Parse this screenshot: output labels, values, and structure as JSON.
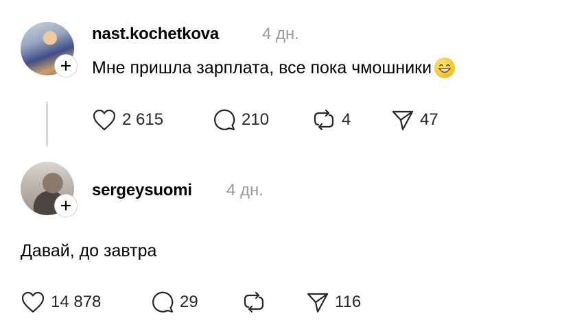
{
  "posts": [
    {
      "username": "nast.kochetkova",
      "time": "4 дн.",
      "text": "Мне пришла зарплата, все пока чмошники",
      "emoji": "grinning-face-with-smiling-eyes",
      "likes": "2 615",
      "comments": "210",
      "reposts": "4",
      "shares": "47"
    },
    {
      "username": "sergeysuomi",
      "time": "4 дн.",
      "text": "Давай, до завтра",
      "likes": "14 878",
      "comments": "29",
      "reposts": "",
      "shares": "116"
    }
  ],
  "icons": {
    "like": "heart-icon",
    "comment": "comment-icon",
    "repost": "repost-icon",
    "share": "send-icon",
    "follow": "plus-icon"
  },
  "colors": {
    "text": "#000000",
    "muted": "#999999",
    "thread_line": "#d9d9d9"
  }
}
